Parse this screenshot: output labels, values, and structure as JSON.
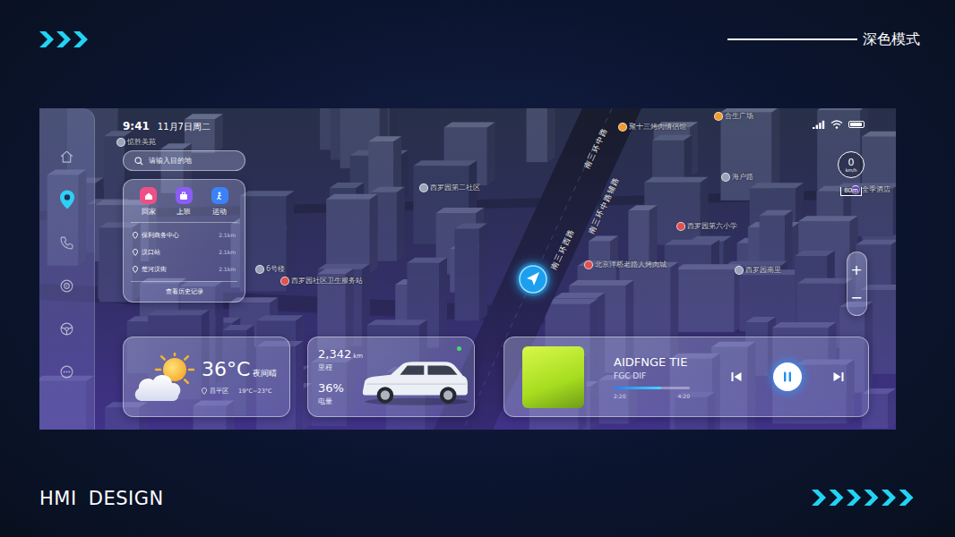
{
  "header": {
    "chevrons": 3,
    "title": "深色模式"
  },
  "footer": {
    "title": "HMI DESIGN",
    "chevrons": 6
  },
  "status_bar": {
    "time": "9:41",
    "date": "11月7日周二",
    "signal_level": 1,
    "wifi": true,
    "battery_level": 0.9
  },
  "sidebar": {
    "items": [
      {
        "selected": false
      },
      {
        "selected": true
      },
      {
        "selected": false
      },
      {
        "selected": false
      },
      {
        "selected": false
      },
      {
        "selected": false
      }
    ]
  },
  "search": {
    "placeholder": "请输入目的地"
  },
  "quick_destinations": [
    {
      "label": "回家",
      "color": "#ef4f86"
    },
    {
      "label": "上班",
      "color": "#8b5cf6"
    },
    {
      "label": "运动",
      "color": "#3b82f6"
    }
  ],
  "recent_places": [
    {
      "name": "保利商务中心",
      "distance": "2.1km"
    },
    {
      "name": "汉口站",
      "distance": "2.1km"
    },
    {
      "name": "楚河汉街",
      "distance": "2.1km"
    }
  ],
  "history_link": "查看历史记录",
  "map": {
    "labels": [
      {
        "text": "惦胜美苑",
        "kind": "area",
        "color": "#9aa3b8"
      },
      {
        "text": "西罗园第二社区",
        "kind": "area",
        "color": "#9aa3b8"
      },
      {
        "text": "南三环中路",
        "kind": "road",
        "color": "#ffffff"
      },
      {
        "text": "南三环中路辅路",
        "kind": "road",
        "color": "#ffffff"
      },
      {
        "text": "南三环西路",
        "kind": "road",
        "color": "#ffffff"
      },
      {
        "text": "聚十三烤肉情侣馆",
        "kind": "poi",
        "color": "#f29a2e"
      },
      {
        "text": "合生广场",
        "kind": "poi",
        "color": "#f29a2e"
      },
      {
        "text": "海户路",
        "kind": "area",
        "color": "#9aa3b8"
      },
      {
        "text": "西罗园第六小学",
        "kind": "poi",
        "color": "#e0524f"
      },
      {
        "text": "北京洋桥老路人烤肉城",
        "kind": "poi",
        "color": "#e0524f"
      },
      {
        "text": "西罗园南里",
        "kind": "area",
        "color": "#9aa3b8"
      },
      {
        "text": "6号楼",
        "kind": "area",
        "color": "#9aa3b8"
      },
      {
        "text": "西罗园社区卫生服务站",
        "kind": "poi",
        "color": "#e0524f"
      },
      {
        "text": "全季酒店",
        "kind": "poi",
        "color": "#8b5cf6"
      }
    ],
    "speed": "0",
    "speed_unit": "km/h",
    "scale": "80m",
    "zoom_in": "+",
    "zoom_out": "−"
  },
  "weather": {
    "temperature": "36°C",
    "condition": "夜间晴",
    "location": "昌平区",
    "range": "19°C~23°C"
  },
  "vehicle": {
    "mileage": "2,342",
    "mileage_unit": "km",
    "mileage_label": "里程",
    "battery": "36%",
    "battery_label": "电量",
    "connected": true
  },
  "music": {
    "title": "AIDFNGE TIE",
    "artist": "FGC DIF",
    "elapsed": "2:20",
    "total": "4:20",
    "level": 0.62,
    "playing": true
  }
}
